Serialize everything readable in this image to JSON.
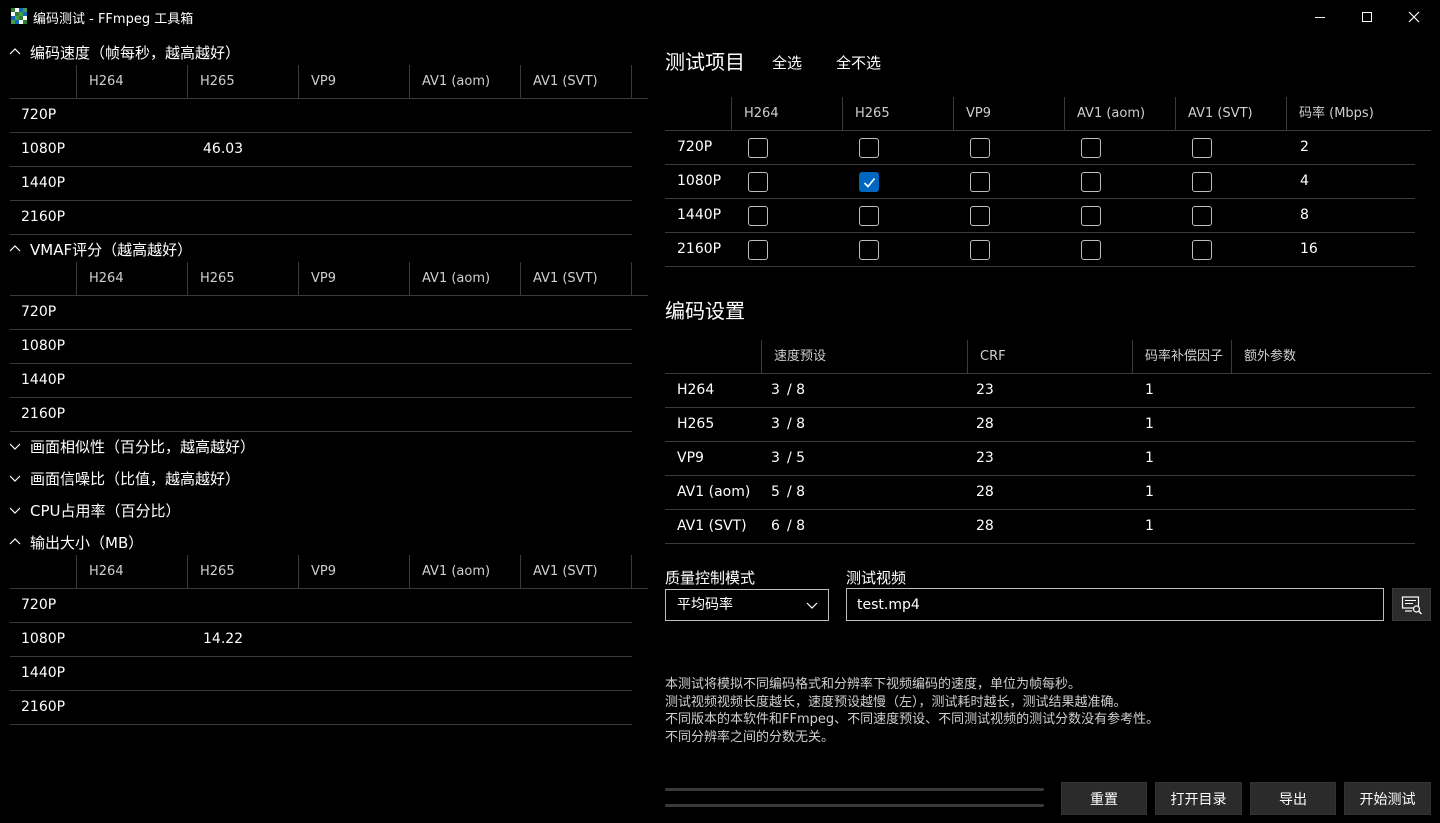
{
  "window": {
    "title": "编码测试 - FFmpeg 工具箱",
    "icon_colors": [
      "#2e7d32",
      "#ffffff",
      "#1565c0",
      "#43a047"
    ]
  },
  "results": {
    "columns": [
      "H264",
      "H265",
      "VP9",
      "AV1 (aom)",
      "AV1 (SVT)"
    ],
    "rows": [
      "720P",
      "1080P",
      "1440P",
      "2160P"
    ],
    "sections": [
      {
        "title": "编码速度（帧每秒，越高越好）",
        "expanded": true,
        "values": [
          [
            "",
            "",
            "",
            "",
            ""
          ],
          [
            "",
            "46.03",
            "",
            "",
            ""
          ],
          [
            "",
            "",
            "",
            "",
            ""
          ],
          [
            "",
            "",
            "",
            "",
            ""
          ]
        ]
      },
      {
        "title": "VMAF评分（越高越好）",
        "expanded": true,
        "values": [
          [
            "",
            "",
            "",
            "",
            ""
          ],
          [
            "",
            "",
            "",
            "",
            ""
          ],
          [
            "",
            "",
            "",
            "",
            ""
          ],
          [
            "",
            "",
            "",
            "",
            ""
          ]
        ]
      },
      {
        "title": "画面相似性（百分比，越高越好）",
        "expanded": false
      },
      {
        "title": "画面信噪比（比值，越高越好）",
        "expanded": false
      },
      {
        "title": "CPU占用率（百分比）",
        "expanded": false
      },
      {
        "title": "输出大小（MB）",
        "expanded": true,
        "values": [
          [
            "",
            "",
            "",
            "",
            ""
          ],
          [
            "",
            "14.22",
            "",
            "",
            ""
          ],
          [
            "",
            "",
            "",
            "",
            ""
          ],
          [
            "",
            "",
            "",
            "",
            ""
          ]
        ]
      }
    ]
  },
  "test_items": {
    "title": "测试项目",
    "select_all": "全选",
    "select_none": "全不选",
    "columns": [
      "H264",
      "H265",
      "VP9",
      "AV1 (aom)",
      "AV1 (SVT)",
      "码率 (Mbps)"
    ],
    "rows": [
      {
        "label": "720P",
        "checks": [
          false,
          false,
          false,
          false,
          false
        ],
        "bitrate": "2"
      },
      {
        "label": "1080P",
        "checks": [
          false,
          true,
          false,
          false,
          false
        ],
        "bitrate": "4"
      },
      {
        "label": "1440P",
        "checks": [
          false,
          false,
          false,
          false,
          false
        ],
        "bitrate": "8"
      },
      {
        "label": "2160P",
        "checks": [
          false,
          false,
          false,
          false,
          false
        ],
        "bitrate": "16"
      }
    ]
  },
  "encode_settings": {
    "title": "编码设置",
    "columns": [
      "速度预设",
      "CRF",
      "码率补偿因子",
      "额外参数"
    ],
    "rows": [
      {
        "codec": "H264",
        "preset": "3",
        "preset_max": "/ 8",
        "crf": "23",
        "factor": "1",
        "extra": ""
      },
      {
        "codec": "H265",
        "preset": "3",
        "preset_max": "/ 8",
        "crf": "28",
        "factor": "1",
        "extra": ""
      },
      {
        "codec": "VP9",
        "preset": "3",
        "preset_max": "/ 5",
        "crf": "23",
        "factor": "1",
        "extra": ""
      },
      {
        "codec": "AV1 (aom)",
        "preset": "5",
        "preset_max": "/ 8",
        "crf": "28",
        "factor": "1",
        "extra": ""
      },
      {
        "codec": "AV1 (SVT)",
        "preset": "6",
        "preset_max": "/ 8",
        "crf": "28",
        "factor": "1",
        "extra": ""
      }
    ]
  },
  "quality_mode": {
    "label": "质量控制模式",
    "value": "平均码率"
  },
  "test_video": {
    "label": "测试视频",
    "value": "test.mp4"
  },
  "info_lines": [
    "本测试将模拟不同编码格式和分辨率下视频编码的速度，单位为帧每秒。",
    "测试视频视频长度越长，速度预设越慢（左），测试耗时越长，测试结果越准确。",
    "不同版本的本软件和FFmpeg、不同速度预设、不同测试视频的测试分数没有参考性。",
    "不同分辨率之间的分数无关。"
  ],
  "progress": {
    "overall": 0,
    "current": 0
  },
  "buttons": {
    "reset": "重置",
    "open_dir": "打开目录",
    "export": "导出",
    "start": "开始测试"
  }
}
